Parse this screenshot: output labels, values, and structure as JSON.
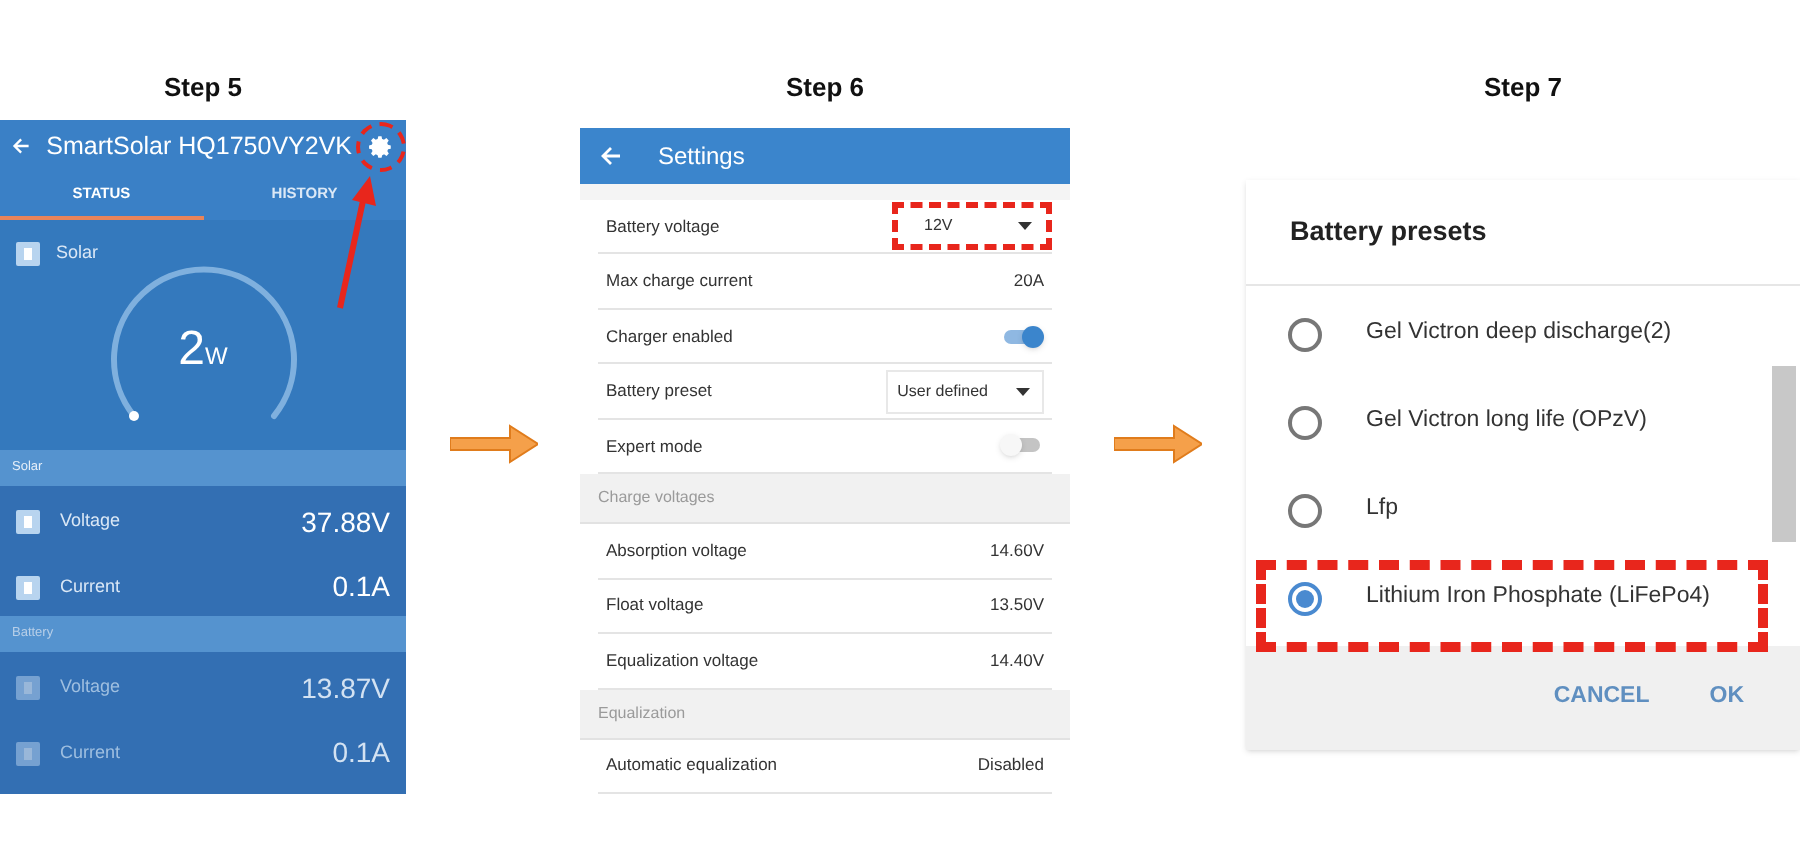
{
  "steps": [
    {
      "title": "Step 5",
      "kind": "status",
      "screen": {
        "title": "SmartSolar HQ1750VY2VK",
        "settings_highlighted": true,
        "tabs": [
          {
            "label": "STATUS",
            "selected": true
          },
          {
            "label": "HISTORY",
            "selected": false
          }
        ],
        "gauge": {
          "label": "Solar",
          "value": "2",
          "unit": "W"
        },
        "sections": [
          {
            "title": "Solar",
            "dim": false,
            "rows": [
              {
                "label": "Voltage",
                "value": "37.88V"
              },
              {
                "label": "Current",
                "value": "0.1A"
              }
            ]
          },
          {
            "title": "Battery",
            "dim": true,
            "rows": [
              {
                "label": "Voltage",
                "value": "13.87V"
              },
              {
                "label": "Current",
                "value": "0.1A"
              }
            ]
          }
        ]
      }
    },
    {
      "title": "Step 6",
      "kind": "settings",
      "screen": {
        "title": "Settings",
        "rows": [
          {
            "kind": "dropdown",
            "label": "Battery voltage",
            "value": "12V",
            "highlighted": true
          },
          {
            "kind": "value",
            "label": "Max charge current",
            "value": "20A"
          },
          {
            "kind": "toggle",
            "label": "Charger enabled",
            "on": true
          },
          {
            "kind": "dropdown",
            "label": "Battery preset",
            "value": "User defined",
            "highlighted": false
          },
          {
            "kind": "toggle",
            "label": "Expert mode",
            "on": false
          },
          {
            "kind": "header",
            "label": "Charge voltages"
          },
          {
            "kind": "value",
            "label": "Absorption voltage",
            "value": "14.60V"
          },
          {
            "kind": "value",
            "label": "Float voltage",
            "value": "13.50V"
          },
          {
            "kind": "value",
            "label": "Equalization voltage",
            "value": "14.40V"
          },
          {
            "kind": "header",
            "label": "Equalization"
          },
          {
            "kind": "value",
            "label": "Automatic equalization",
            "value": "Disabled"
          }
        ]
      }
    },
    {
      "title": "Step 7",
      "kind": "dialog",
      "screen": {
        "title": "Battery presets",
        "options": [
          {
            "label": "Gel Victron deep discharge(2)",
            "selected": false,
            "highlighted": false
          },
          {
            "label": "Gel Victron long life (OPzV)",
            "selected": false,
            "highlighted": false
          },
          {
            "label": "Lfp",
            "selected": false,
            "highlighted": false
          },
          {
            "label": "Lithium Iron Phosphate (LiFePo4)",
            "selected": true,
            "highlighted": true
          }
        ],
        "buttons": [
          "CANCEL",
          "OK"
        ]
      }
    }
  ]
}
